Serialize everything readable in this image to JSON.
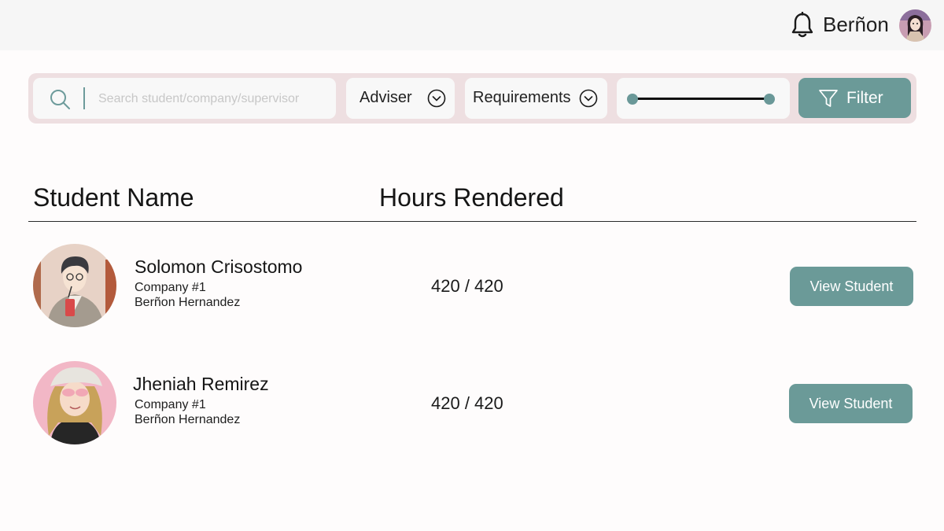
{
  "header": {
    "user_name": "Berñon",
    "notification_icon": "bell-icon",
    "avatar_icon": "user-avatar"
  },
  "filters": {
    "search_placeholder": "Search student/company/supervisor",
    "search_value": "",
    "adviser_label": "Adviser",
    "requirements_label": "Requirements",
    "hours_range": [
      0,
      1
    ],
    "filter_label": "Filter"
  },
  "table": {
    "columns": [
      "Student Name",
      "Hours Rendered"
    ],
    "rows": [
      {
        "name": "Solomon Crisostomo",
        "company": "Company #1",
        "adviser": "Berñon Hernandez",
        "hours": "420 / 420",
        "action": "View Student"
      },
      {
        "name": "Jheniah Remirez",
        "company": "Company #1",
        "adviser": "Berñon Hernandez",
        "hours": "420 / 420",
        "action": "View Student"
      }
    ]
  },
  "colors": {
    "accent": "#6b9a98",
    "filter_bar": "#eedfe1",
    "topbar": "#f6f6f6"
  }
}
